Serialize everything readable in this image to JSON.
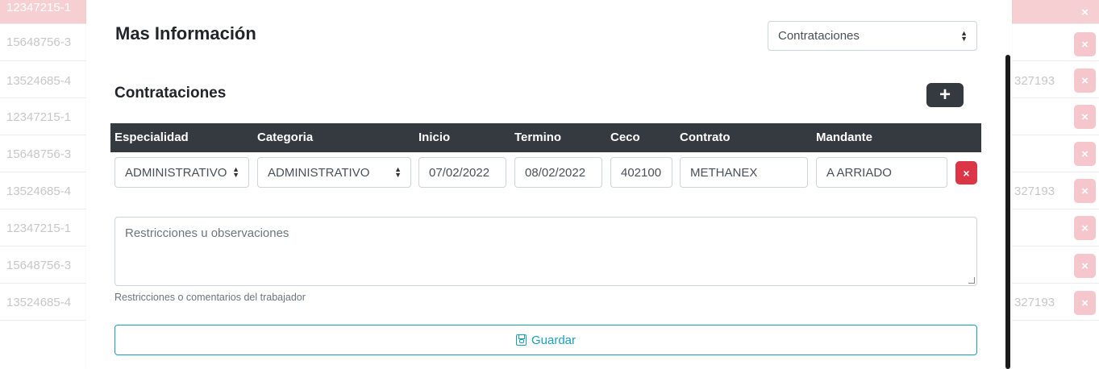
{
  "background_rows": [
    {
      "rut": "12347215-1",
      "extra": ""
    },
    {
      "rut": "15648756-3",
      "extra": ""
    },
    {
      "rut": "13524685-4",
      "extra": "327193"
    },
    {
      "rut": "12347215-1",
      "extra": ""
    },
    {
      "rut": "15648756-3",
      "extra": ""
    },
    {
      "rut": "13524685-4",
      "extra": "327193"
    },
    {
      "rut": "12347215-1",
      "extra": ""
    },
    {
      "rut": "15648756-3",
      "extra": ""
    },
    {
      "rut": "13524685-4",
      "extra": "327193"
    }
  ],
  "background_delete_label": "×",
  "modal": {
    "title": "Mas Información",
    "view_select": {
      "value": "Contrataciones"
    },
    "section_title": "Contrataciones",
    "add_label": "+",
    "table": {
      "headers": [
        "Especialidad",
        "Categoria",
        "Inicio",
        "Termino",
        "Ceco",
        "Contrato",
        "Mandante"
      ],
      "row": {
        "especialidad": "ADMINISTRATIVO",
        "categoria": "ADMINISTRATIVO",
        "inicio": "07/02/2022",
        "termino": "08/02/2022",
        "ceco": "402100",
        "contrato": "METHANEX",
        "mandante": "A ARRIADO"
      },
      "delete_label": "×"
    },
    "observations": {
      "placeholder": "Restricciones u observaciones",
      "help": "Restricciones o comentarios del trabajador"
    },
    "save_label": "Guardar"
  },
  "colors": {
    "danger": "#dc3545",
    "info": "#17a2b8",
    "dark": "#343a40"
  }
}
